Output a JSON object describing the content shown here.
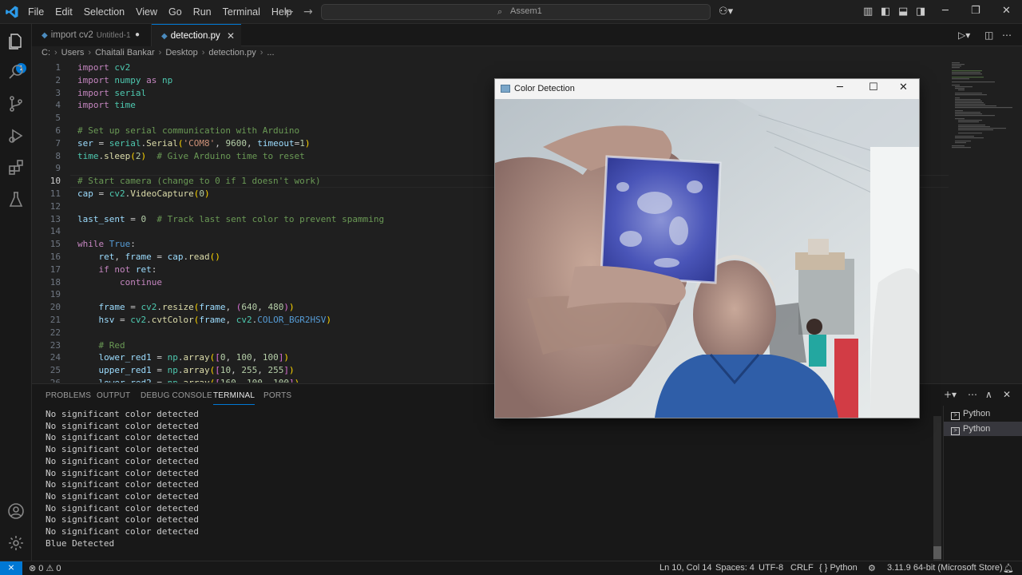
{
  "titlebar": {
    "menu": [
      "File",
      "Edit",
      "Selection",
      "View",
      "Go",
      "Run",
      "Terminal",
      "Help"
    ],
    "search_text": "Assem1"
  },
  "tabs": [
    {
      "label": "import cv2",
      "sub": "Untitled-1",
      "modified": true
    },
    {
      "label": "detection.py",
      "active": true
    }
  ],
  "breadcrumb": [
    "C:",
    "Users",
    "Chaitali Bankar",
    "Desktop",
    "detection.py",
    "..."
  ],
  "editor": {
    "current_line": 10,
    "lines": [
      {
        "n": "1",
        "text": "import cv2"
      },
      {
        "n": "2",
        "text": "import numpy as np"
      },
      {
        "n": "3",
        "text": "import serial"
      },
      {
        "n": "4",
        "text": "import time"
      },
      {
        "n": "5",
        "text": ""
      },
      {
        "n": "6",
        "text": "# Set up serial communication with Arduino"
      },
      {
        "n": "7",
        "text": "ser = serial.Serial('COM8', 9600, timeout=1)"
      },
      {
        "n": "8",
        "text": "time.sleep(2)  # Give Arduino time to reset"
      },
      {
        "n": "9",
        "text": ""
      },
      {
        "n": "10",
        "text": "# Start camera (change to 0 if 1 doesn't work)"
      },
      {
        "n": "11",
        "text": "cap = cv2.VideoCapture(0)"
      },
      {
        "n": "12",
        "text": ""
      },
      {
        "n": "13",
        "text": "last_sent = 0  # Track last sent color to prevent spamming"
      },
      {
        "n": "14",
        "text": ""
      },
      {
        "n": "15",
        "text": "while True:"
      },
      {
        "n": "16",
        "text": "    ret, frame = cap.read()"
      },
      {
        "n": "17",
        "text": "    if not ret:"
      },
      {
        "n": "18",
        "text": "        continue"
      },
      {
        "n": "19",
        "text": ""
      },
      {
        "n": "20",
        "text": "    frame = cv2.resize(frame, (640, 480))"
      },
      {
        "n": "21",
        "text": "    hsv = cv2.cvtColor(frame, cv2.COLOR_BGR2HSV)"
      },
      {
        "n": "22",
        "text": ""
      },
      {
        "n": "23",
        "text": "    # Red"
      },
      {
        "n": "24",
        "text": "    lower_red1 = np.array([0, 100, 100])"
      },
      {
        "n": "25",
        "text": "    upper_red1 = np.array([10, 255, 255])"
      },
      {
        "n": "26",
        "text": "    lower_red2 = np.array([160, 100, 100])"
      }
    ]
  },
  "panel": {
    "tabs": [
      "PROBLEMS",
      "OUTPUT",
      "DEBUG CONSOLE",
      "TERMINAL",
      "PORTS"
    ],
    "active_tab": "TERMINAL",
    "terminal_lines": [
      "No significant color detected",
      "No significant color detected",
      "No significant color detected",
      "No significant color detected",
      "No significant color detected",
      "No significant color detected",
      "No significant color detected",
      "No significant color detected",
      "No significant color detected",
      "No significant color detected",
      "No significant color detected",
      "Blue Detected"
    ],
    "terminals": [
      "Python",
      "Python"
    ]
  },
  "statusbar": {
    "errors": "0",
    "warnings": "0",
    "position": "Ln 10, Col 14",
    "spaces": "Spaces: 4",
    "encoding": "UTF-8",
    "eol": "CRLF",
    "language": "Python",
    "interpreter": "3.11.9 64-bit (Microsoft Store)"
  },
  "opencv_window": {
    "title": "Color Detection"
  },
  "colors": {
    "accent": "#0078d4",
    "editor_bg": "#1f1f1f",
    "panel_bg": "#181818",
    "object_blue": "#3a4aa8"
  }
}
